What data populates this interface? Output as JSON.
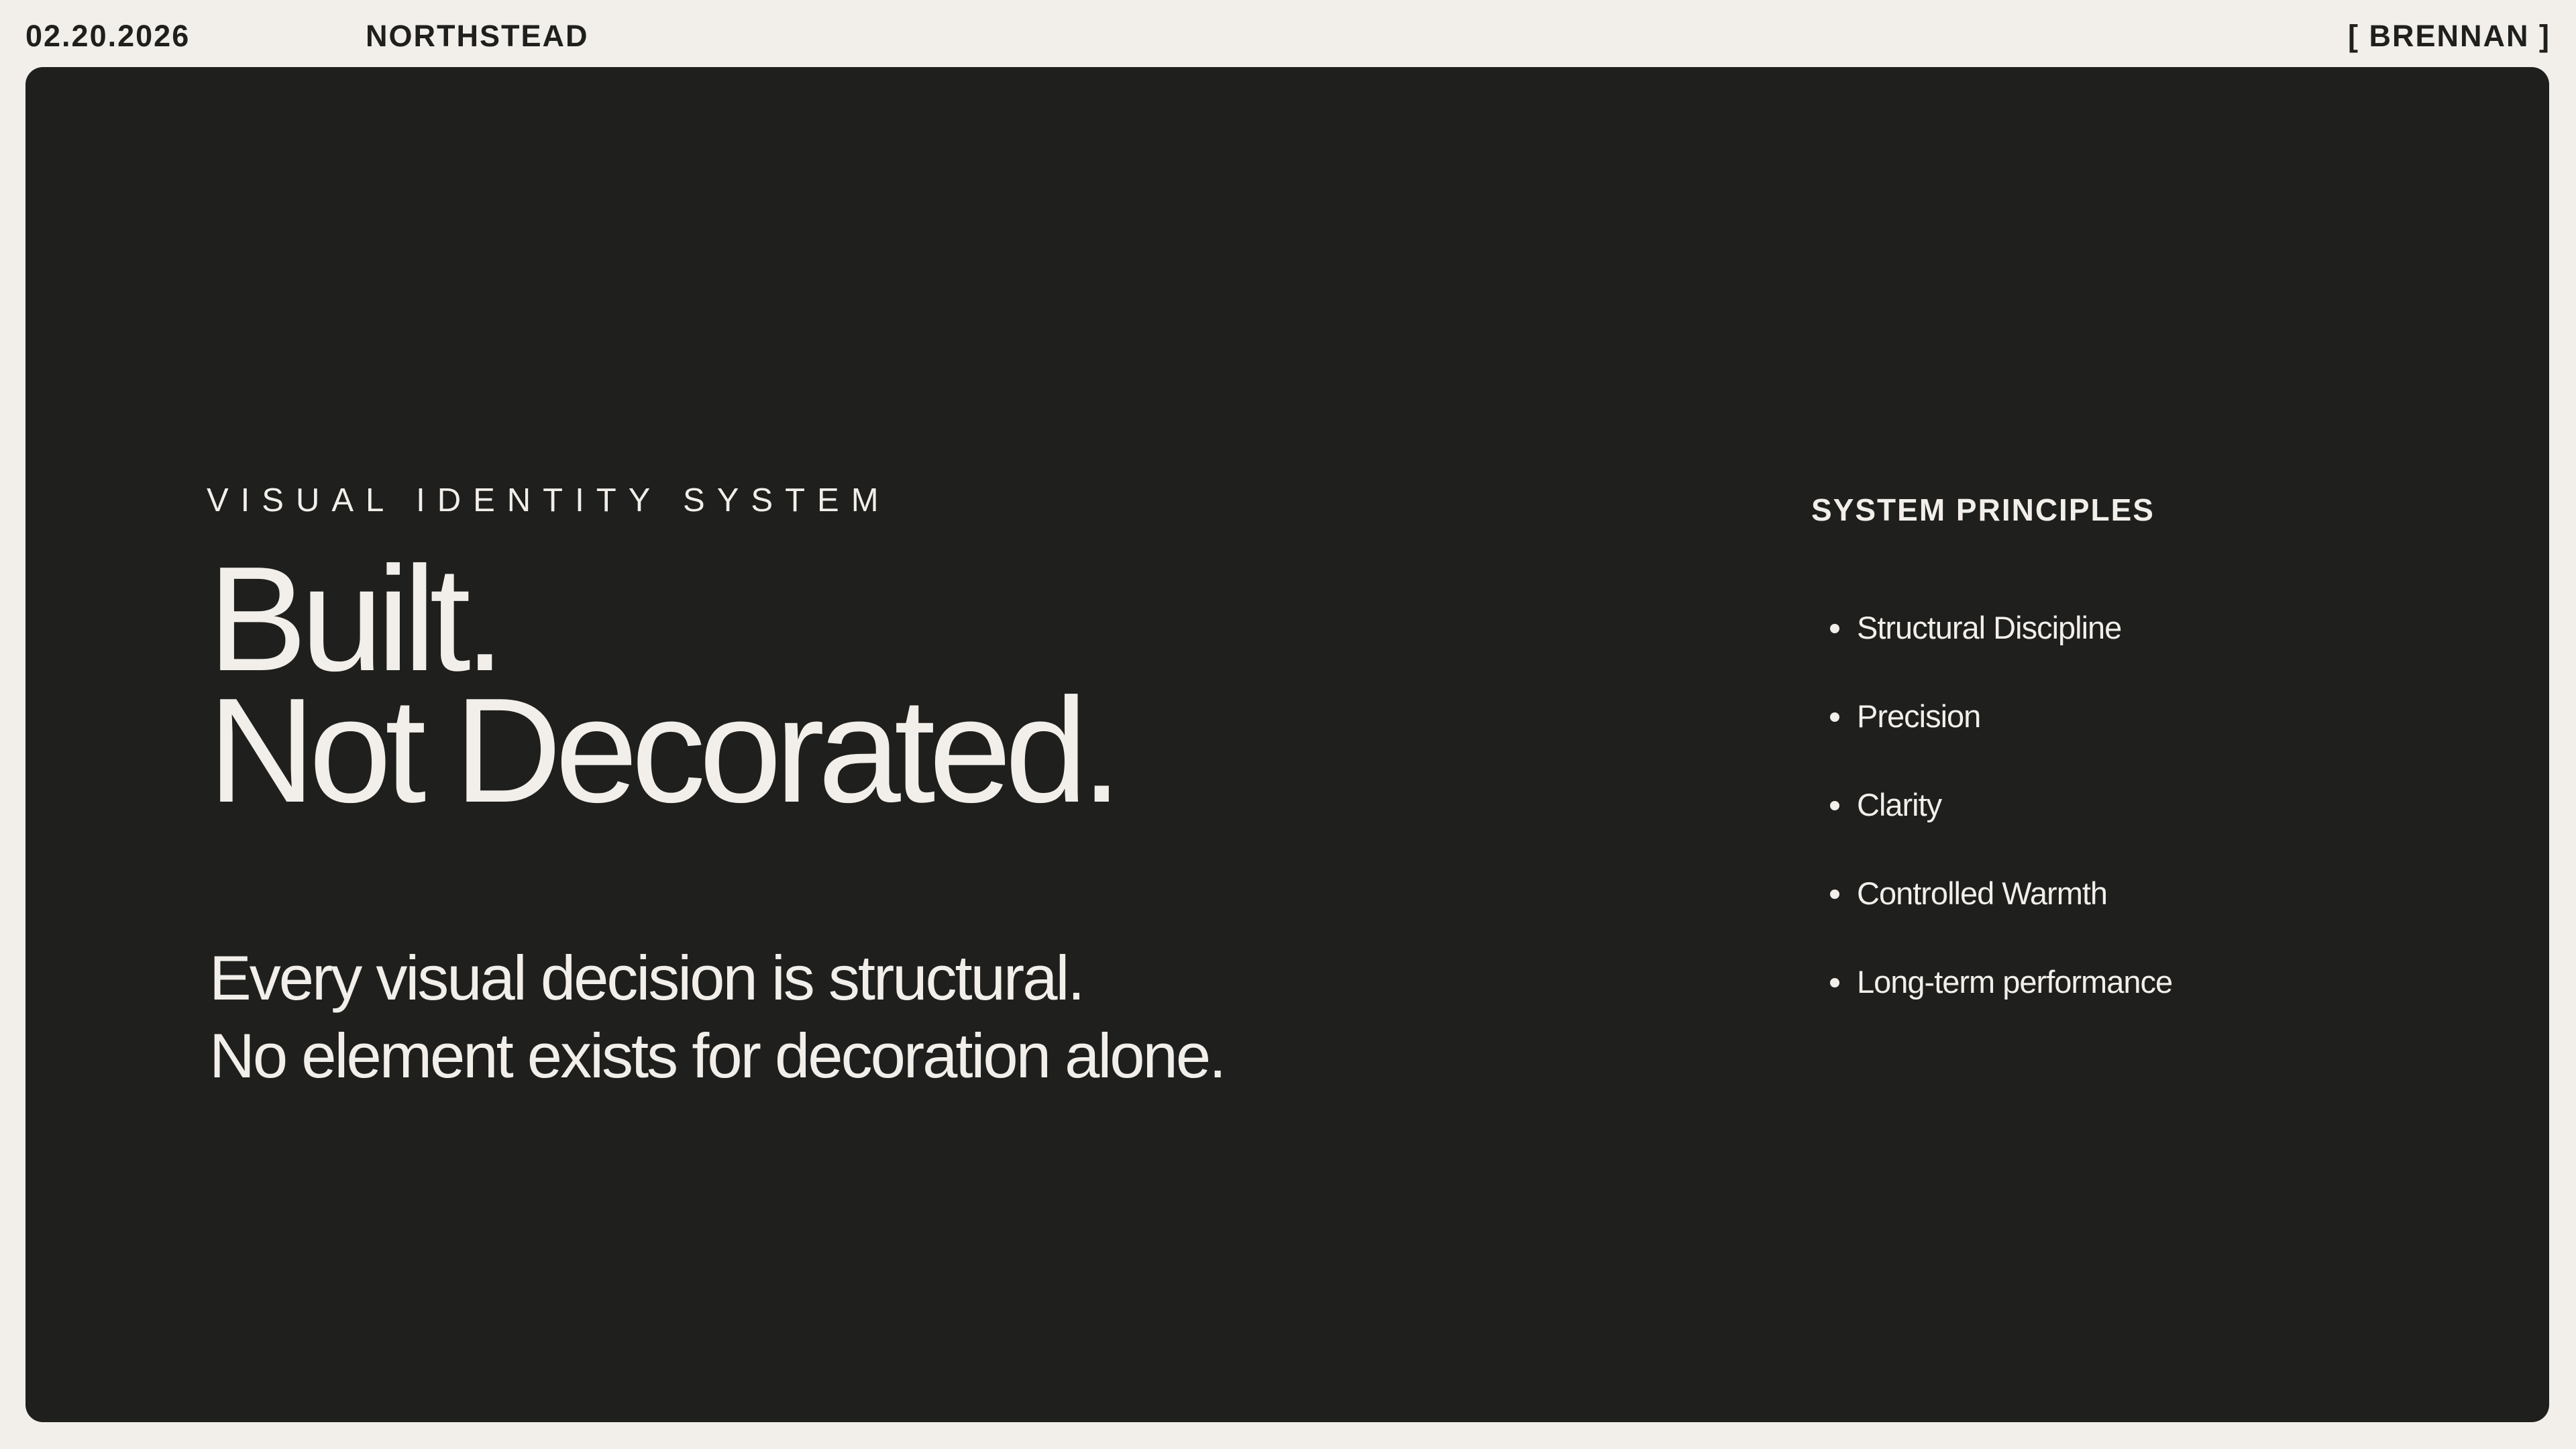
{
  "header": {
    "date": "02.20.2026",
    "brand": "NORTHSTEAD",
    "client": "[ BRENNAN ]"
  },
  "slide": {
    "eyebrow": "VISUAL IDENTITY SYSTEM",
    "headline_line1": "Built.",
    "headline_line2": "Not Decorated.",
    "subhead_line1": "Every visual decision is structural.",
    "subhead_line2": "No element exists for decoration alone.",
    "principles_title": "SYSTEM PRINCIPLES",
    "principles": [
      "Structural Discipline",
      "Precision",
      "Clarity",
      "Controlled Warmth",
      "Long-term performance"
    ]
  },
  "colors": {
    "page_background": "#f2efea",
    "panel_background": "#1f1f1d",
    "text_dark": "#1f1f1d",
    "text_light": "#f2efea"
  }
}
